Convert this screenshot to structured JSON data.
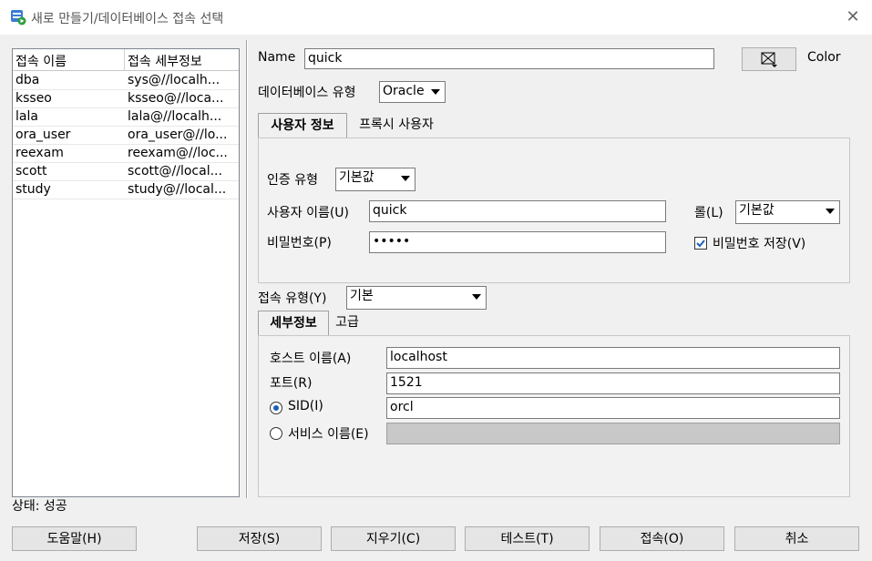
{
  "window": {
    "title": "새로 만들기/데이터베이스 접속 선택"
  },
  "connections": {
    "headers": [
      "접속 이름",
      "접속 세부정보"
    ],
    "rows": [
      [
        "dba",
        "sys@//localh..."
      ],
      [
        "ksseo",
        "ksseo@//loca..."
      ],
      [
        "lala",
        "lala@//localh..."
      ],
      [
        "ora_user",
        "ora_user@//lo..."
      ],
      [
        "reexam",
        "reexam@//loc..."
      ],
      [
        "scott",
        "scott@//local..."
      ],
      [
        "study",
        "study@//local..."
      ]
    ]
  },
  "form": {
    "name_label": "Name",
    "name_value": "quick",
    "color_label": "Color",
    "db_type_label": "데이터베이스 유형",
    "db_type_value": "Oracle",
    "tabs_user": [
      "사용자 정보",
      "프록시 사용자"
    ],
    "auth_type_label": "인증 유형",
    "auth_type_value": "기본값",
    "username_label": "사용자 이름(U)",
    "username_value": "quick",
    "role_label": "롤(L)",
    "role_value": "기본값",
    "password_label": "비밀번호(P)",
    "password_value": "•••••",
    "save_password_label": "비밀번호 저장(V)",
    "save_password_checked": true,
    "conn_type_label": "접속 유형(Y)",
    "conn_type_value": "기본",
    "tabs_detail": [
      "세부정보",
      "고급"
    ],
    "host_label": "호스트 이름(A)",
    "host_value": "localhost",
    "port_label": "포트(R)",
    "port_value": "1521",
    "sid_label": "SID(I)",
    "sid_value": "orcl",
    "service_label": "서비스 이름(E)",
    "service_value": ""
  },
  "status": "상태: 성공",
  "buttons": {
    "help": "도움말(H)",
    "save": "저장(S)",
    "clear": "지우기(C)",
    "test": "테스트(T)",
    "connect": "접속(O)",
    "cancel": "취소"
  },
  "colors": {
    "accent": "#1a5fb4",
    "icon_green": "#2e9e3e"
  }
}
